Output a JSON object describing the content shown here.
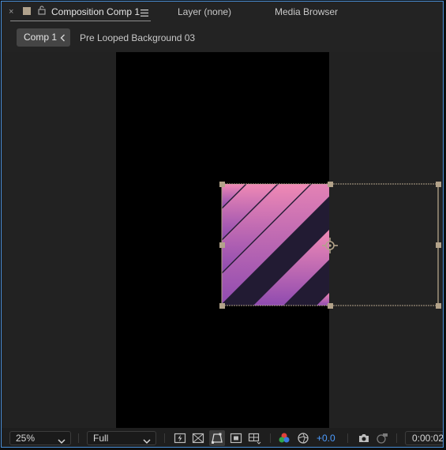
{
  "tabs": {
    "close_glyph": "×",
    "active_label": "Composition Comp 1",
    "layer_label": "Layer (none)",
    "media_label": "Media Browser"
  },
  "breadcrumb": {
    "current": "Comp 1",
    "next": "Pre Looped Background 03"
  },
  "toolbar": {
    "zoom": "25%",
    "resolution": "Full",
    "exposure": "+0.0",
    "timecode": "0:00:02:"
  },
  "colors": {
    "accent_blue": "#4d9cff",
    "panel_border": "#4a8fd8",
    "stripe_pink": "#f08ab5",
    "stripe_purple": "#8f4bb0",
    "stripe_dark": "#221b33",
    "handle_tan": "#b3a38a"
  },
  "icons": {
    "lock": "lock-icon",
    "menu": "hamburger-menu-icon",
    "anchor": "anchor-point-icon"
  }
}
